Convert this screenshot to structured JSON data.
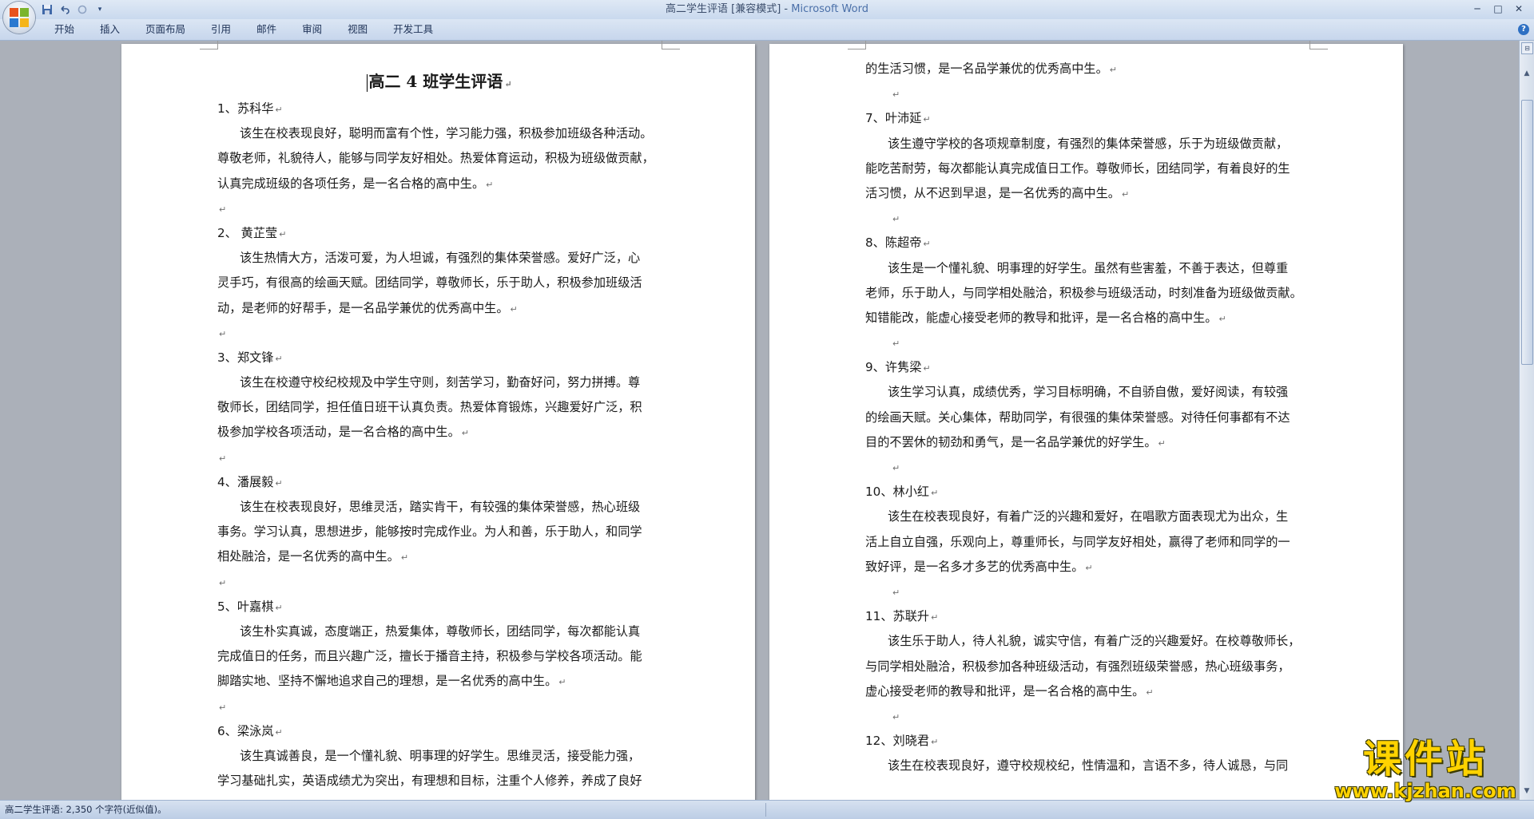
{
  "window": {
    "title": "高二学生评语 [兼容模式]",
    "title_sep": " - ",
    "app_name": "Microsoft Word",
    "minimize": "─",
    "maximize": "□",
    "close": "✕"
  },
  "qat": {
    "save_icon": "save-icon",
    "undo_icon": "undo-icon",
    "redo_icon": "redo-icon",
    "customize_icon": "customize-icon"
  },
  "ribbon": {
    "tabs": [
      "开始",
      "插入",
      "页面布局",
      "引用",
      "邮件",
      "审阅",
      "视图",
      "开发工具"
    ],
    "help": "?"
  },
  "page1": {
    "title": "高二 4 班学生评语",
    "entries": [
      {
        "name": "1、苏科华",
        "lines": [
          "该生在校表现良好，聪明而富有个性，学习能力强，积极参加班级各种活动。",
          "尊敬老师，礼貌待人，能够与同学友好相处。热爱体育运动，积极为班级做贡献，",
          "认真完成班级的各项任务，是一名合格的高中生。"
        ]
      },
      {
        "name": "2、 黄芷莹",
        "lines": [
          "该生热情大方，活泼可爱，为人坦诚，有强烈的集体荣誉感。爱好广泛，心",
          "灵手巧，有很高的绘画天赋。团结同学，尊敬师长，乐于助人，积极参加班级活",
          "动，是老师的好帮手，是一名品学兼优的优秀高中生。"
        ]
      },
      {
        "name": "3、郑文锋",
        "lines": [
          "该生在校遵守校纪校规及中学生守则，刻苦学习，勤奋好问，努力拼搏。尊",
          "敬师长，团结同学，担任值日班干认真负责。热爱体育锻炼，兴趣爱好广泛，积",
          "极参加学校各项活动，是一名合格的高中生。"
        ]
      },
      {
        "name": "4、潘展毅",
        "lines": [
          "该生在校表现良好，思维灵活，踏实肯干，有较强的集体荣誉感，热心班级",
          "事务。学习认真，思想进步，能够按时完成作业。为人和善，乐于助人，和同学",
          "相处融洽，是一名优秀的高中生。"
        ]
      },
      {
        "name": "5、叶嘉棋",
        "lines": [
          "该生朴实真诚，态度端正，热爱集体，尊敬师长，团结同学，每次都能认真",
          "完成值日的任务，而且兴趣广泛，擅长于播音主持，积极参与学校各项活动。能",
          "脚踏实地、坚持不懈地追求自己的理想，是一名优秀的高中生。"
        ]
      },
      {
        "name": "6、梁泳岚",
        "lines": [
          "该生真诚善良，是一个懂礼貌、明事理的好学生。思维灵活，接受能力强，",
          "学习基础扎实，英语成绩尤为突出，有理想和目标，注重个人修养，养成了良好"
        ]
      }
    ]
  },
  "page2": {
    "top_line": "的生活习惯，是一名品学兼优的优秀高中生。",
    "entries": [
      {
        "name": "7、叶沛延",
        "lines": [
          "该生遵守学校的各项规章制度，有强烈的集体荣誉感，乐于为班级做贡献，",
          "能吃苦耐劳，每次都能认真完成值日工作。尊敬师长，团结同学，有着良好的生",
          "活习惯，从不迟到早退，是一名优秀的高中生。"
        ]
      },
      {
        "name": "8、陈超帝",
        "lines": [
          "该生是一个懂礼貌、明事理的好学生。虽然有些害羞，不善于表达，但尊重",
          "老师，乐于助人，与同学相处融洽，积极参与班级活动，时刻准备为班级做贡献。",
          "知错能改，能虚心接受老师的教导和批评，是一名合格的高中生。"
        ]
      },
      {
        "name": "9、许隽梁",
        "lines": [
          "该生学习认真，成绩优秀，学习目标明确，不自骄自傲，爱好阅读，有较强",
          "的绘画天赋。关心集体，帮助同学，有很强的集体荣誉感。对待任何事都有不达",
          "目的不罢休的韧劲和勇气，是一名品学兼优的好学生。"
        ]
      },
      {
        "name": "10、林小红",
        "lines": [
          "该生在校表现良好，有着广泛的兴趣和爱好，在唱歌方面表现尤为出众，生",
          "活上自立自强，乐观向上，尊重师长，与同学友好相处，赢得了老师和同学的一",
          "致好评，是一名多才多艺的优秀高中生。"
        ]
      },
      {
        "name": "11、苏联升",
        "lines": [
          "该生乐于助人，待人礼貌，诚实守信，有着广泛的兴趣爱好。在校尊敬师长，",
          "与同学相处融洽，积极参加各种班级活动，有强烈班级荣誉感，热心班级事务，",
          "虚心接受老师的教导和批评，是一名合格的高中生。"
        ]
      },
      {
        "name": "12、刘晓君",
        "lines": [
          "该生在校表现良好，遵守校规校纪，性情温和，言语不多，待人诚恳，与同"
        ]
      }
    ]
  },
  "para_mark": "↵",
  "statusbar": {
    "text": "高二学生评语: 2,350 个字符(近似值)。"
  },
  "watermark": {
    "big": "课件站",
    "url": "www.kjzhan.com"
  },
  "colors": {
    "accent": "#4a6fa8",
    "watermark": "#ffd300"
  }
}
